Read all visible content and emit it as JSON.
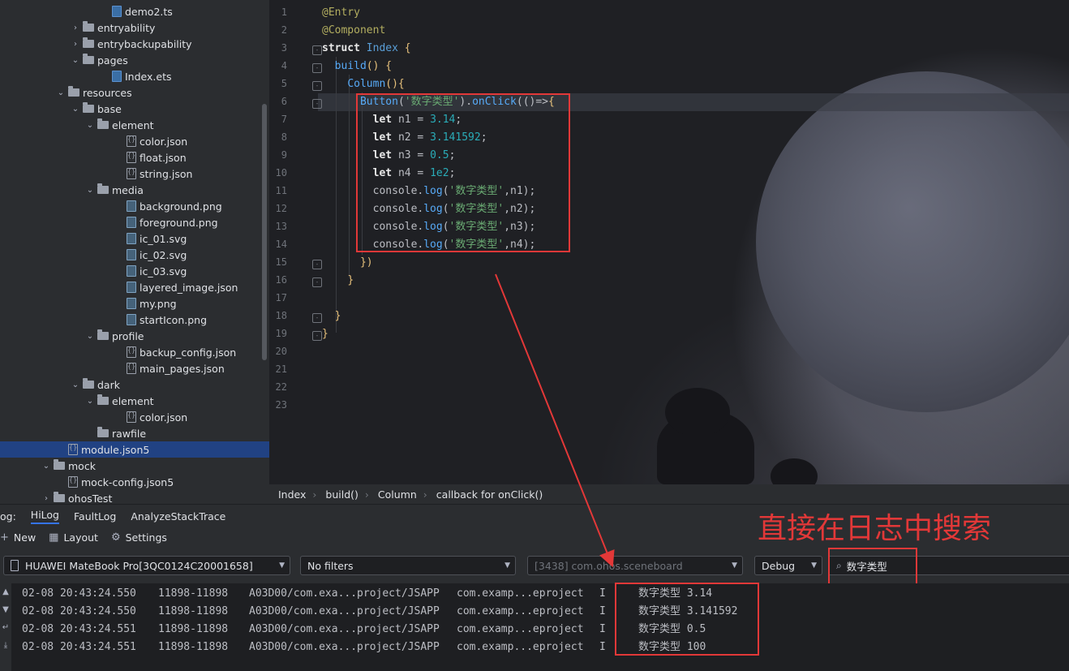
{
  "tree": {
    "items": [
      {
        "label": "demo2.ts",
        "indent": 7,
        "type": "ts",
        "chev": ""
      },
      {
        "label": "entryability",
        "indent": 5,
        "type": "folder",
        "chev": ">"
      },
      {
        "label": "entrybackupability",
        "indent": 5,
        "type": "folder",
        "chev": ">"
      },
      {
        "label": "pages",
        "indent": 5,
        "type": "folder",
        "chev": "v"
      },
      {
        "label": "Index.ets",
        "indent": 7,
        "type": "ts",
        "chev": ""
      },
      {
        "label": "resources",
        "indent": 4,
        "type": "folder",
        "chev": "v"
      },
      {
        "label": "base",
        "indent": 5,
        "type": "folder",
        "chev": "v"
      },
      {
        "label": "element",
        "indent": 6,
        "type": "folder",
        "chev": "v"
      },
      {
        "label": "color.json",
        "indent": 8,
        "type": "json",
        "chev": ""
      },
      {
        "label": "float.json",
        "indent": 8,
        "type": "json",
        "chev": ""
      },
      {
        "label": "string.json",
        "indent": 8,
        "type": "json",
        "chev": ""
      },
      {
        "label": "media",
        "indent": 6,
        "type": "folder",
        "chev": "v"
      },
      {
        "label": "background.png",
        "indent": 8,
        "type": "img",
        "chev": ""
      },
      {
        "label": "foreground.png",
        "indent": 8,
        "type": "img",
        "chev": ""
      },
      {
        "label": "ic_01.svg",
        "indent": 8,
        "type": "img",
        "chev": ""
      },
      {
        "label": "ic_02.svg",
        "indent": 8,
        "type": "img",
        "chev": ""
      },
      {
        "label": "ic_03.svg",
        "indent": 8,
        "type": "img",
        "chev": ""
      },
      {
        "label": "layered_image.json",
        "indent": 8,
        "type": "img",
        "chev": ""
      },
      {
        "label": "my.png",
        "indent": 8,
        "type": "img",
        "chev": ""
      },
      {
        "label": "startIcon.png",
        "indent": 8,
        "type": "img",
        "chev": ""
      },
      {
        "label": "profile",
        "indent": 6,
        "type": "folder",
        "chev": "v"
      },
      {
        "label": "backup_config.json",
        "indent": 8,
        "type": "json",
        "chev": ""
      },
      {
        "label": "main_pages.json",
        "indent": 8,
        "type": "json",
        "chev": ""
      },
      {
        "label": "dark",
        "indent": 5,
        "type": "folder",
        "chev": "v"
      },
      {
        "label": "element",
        "indent": 6,
        "type": "folder",
        "chev": "v"
      },
      {
        "label": "color.json",
        "indent": 8,
        "type": "json",
        "chev": ""
      },
      {
        "label": "rawfile",
        "indent": 6,
        "type": "folder",
        "chev": ""
      },
      {
        "label": "module.json5",
        "indent": 4,
        "type": "json",
        "chev": "",
        "selected": true
      },
      {
        "label": "mock",
        "indent": 3,
        "type": "folder",
        "chev": "v"
      },
      {
        "label": "mock-config.json5",
        "indent": 4,
        "type": "json",
        "chev": ""
      },
      {
        "label": "ohosTest",
        "indent": 3,
        "type": "folder",
        "chev": ">"
      }
    ]
  },
  "editor": {
    "line_numbers": [
      "1",
      "2",
      "3",
      "4",
      "5",
      "6",
      "7",
      "8",
      "9",
      "10",
      "11",
      "12",
      "13",
      "14",
      "15",
      "16",
      "17",
      "18",
      "19",
      "20",
      "21",
      "22",
      "23"
    ],
    "lines": [
      [
        [
          "a",
          "@Entry"
        ]
      ],
      [
        [
          "a",
          "@Component"
        ]
      ],
      [
        [
          "b",
          "struct "
        ],
        [
          "c",
          "Index "
        ],
        [
          "y",
          "{"
        ]
      ],
      [
        [
          "t",
          "  "
        ],
        [
          "f",
          "build"
        ],
        [
          "y",
          "() {"
        ]
      ],
      [
        [
          "t",
          "    "
        ],
        [
          "f",
          "Column"
        ],
        [
          "y",
          "(){"
        ]
      ],
      [
        [
          "t",
          "      "
        ],
        [
          "f",
          "Button"
        ],
        [
          "t",
          "("
        ],
        [
          "s",
          "'数字类型'"
        ],
        [
          "t",
          ")."
        ],
        [
          "f",
          "onClick"
        ],
        [
          "t",
          "(()=>"
        ],
        [
          "y",
          "{"
        ]
      ],
      [
        [
          "t",
          "        "
        ],
        [
          "b",
          "let "
        ],
        [
          "t",
          "n1 = "
        ],
        [
          "n",
          "3.14"
        ],
        [
          "t",
          ";"
        ]
      ],
      [
        [
          "t",
          "        "
        ],
        [
          "b",
          "let "
        ],
        [
          "t",
          "n2 = "
        ],
        [
          "n",
          "3.141592"
        ],
        [
          "t",
          ";"
        ]
      ],
      [
        [
          "t",
          "        "
        ],
        [
          "b",
          "let "
        ],
        [
          "t",
          "n3 = "
        ],
        [
          "n",
          "0.5"
        ],
        [
          "t",
          ";"
        ]
      ],
      [
        [
          "t",
          "        "
        ],
        [
          "b",
          "let "
        ],
        [
          "t",
          "n4 = "
        ],
        [
          "n",
          "1e2"
        ],
        [
          "t",
          ";"
        ]
      ],
      [
        [
          "t",
          "        console."
        ],
        [
          "f",
          "log"
        ],
        [
          "t",
          "("
        ],
        [
          "s",
          "'数字类型'"
        ],
        [
          "t",
          ",n1);"
        ]
      ],
      [
        [
          "t",
          "        console."
        ],
        [
          "f",
          "log"
        ],
        [
          "t",
          "("
        ],
        [
          "s",
          "'数字类型'"
        ],
        [
          "t",
          ",n2);"
        ]
      ],
      [
        [
          "t",
          "        console."
        ],
        [
          "f",
          "log"
        ],
        [
          "t",
          "("
        ],
        [
          "s",
          "'数字类型'"
        ],
        [
          "t",
          ",n3);"
        ]
      ],
      [
        [
          "t",
          "        console."
        ],
        [
          "f",
          "log"
        ],
        [
          "t",
          "("
        ],
        [
          "s",
          "'数字类型'"
        ],
        [
          "t",
          ",n4);"
        ]
      ],
      [
        [
          "t",
          "      "
        ],
        [
          "y",
          "})"
        ]
      ],
      [
        [
          "t",
          "    "
        ],
        [
          "y",
          "}"
        ]
      ],
      [
        [
          "t",
          ""
        ]
      ],
      [
        [
          "t",
          "  "
        ],
        [
          "y",
          "}"
        ]
      ],
      [
        [
          "y",
          "}"
        ]
      ],
      [
        [
          "t",
          ""
        ]
      ],
      [
        [
          "t",
          ""
        ]
      ],
      [
        [
          "t",
          ""
        ]
      ],
      [
        [
          "t",
          ""
        ]
      ]
    ]
  },
  "breadcrumb": {
    "items": [
      "Index",
      "build()",
      "Column",
      "callback for onClick()"
    ]
  },
  "log_tabs": {
    "prefix": "og:",
    "items": [
      "HiLog",
      "FaultLog",
      "AnalyzeStackTrace"
    ],
    "active": "HiLog"
  },
  "log_toolbar": {
    "new_label": "New",
    "layout_label": "Layout",
    "settings_label": "Settings"
  },
  "filters": {
    "device": "HUAWEI MateBook Pro[3QC0124C20001658]",
    "filter": "No filters",
    "process": "[3438] com.ohos.sceneboard",
    "level": "Debug",
    "search": "数字类型"
  },
  "logs": [
    {
      "time": "02-08 20:43:24.550",
      "pid": "11898-11898",
      "tag": "A03D00/com.exa...project/JSAPP",
      "pkg": "com.examp...eproject",
      "level": "I",
      "msg": "数字类型 3.14"
    },
    {
      "time": "02-08 20:43:24.550",
      "pid": "11898-11898",
      "tag": "A03D00/com.exa...project/JSAPP",
      "pkg": "com.examp...eproject",
      "level": "I",
      "msg": "数字类型 3.141592"
    },
    {
      "time": "02-08 20:43:24.551",
      "pid": "11898-11898",
      "tag": "A03D00/com.exa...project/JSAPP",
      "pkg": "com.examp...eproject",
      "level": "I",
      "msg": "数字类型 0.5"
    },
    {
      "time": "02-08 20:43:24.551",
      "pid": "11898-11898",
      "tag": "A03D00/com.exa...project/JSAPP",
      "pkg": "com.examp...eproject",
      "level": "I",
      "msg": "数字类型 100"
    }
  ],
  "annotation": {
    "text": "直接在日志中搜索",
    "color": "#e23838"
  },
  "colors": {
    "accent": "#3574f0",
    "highlight": "#e23838",
    "selection": "#214283"
  }
}
